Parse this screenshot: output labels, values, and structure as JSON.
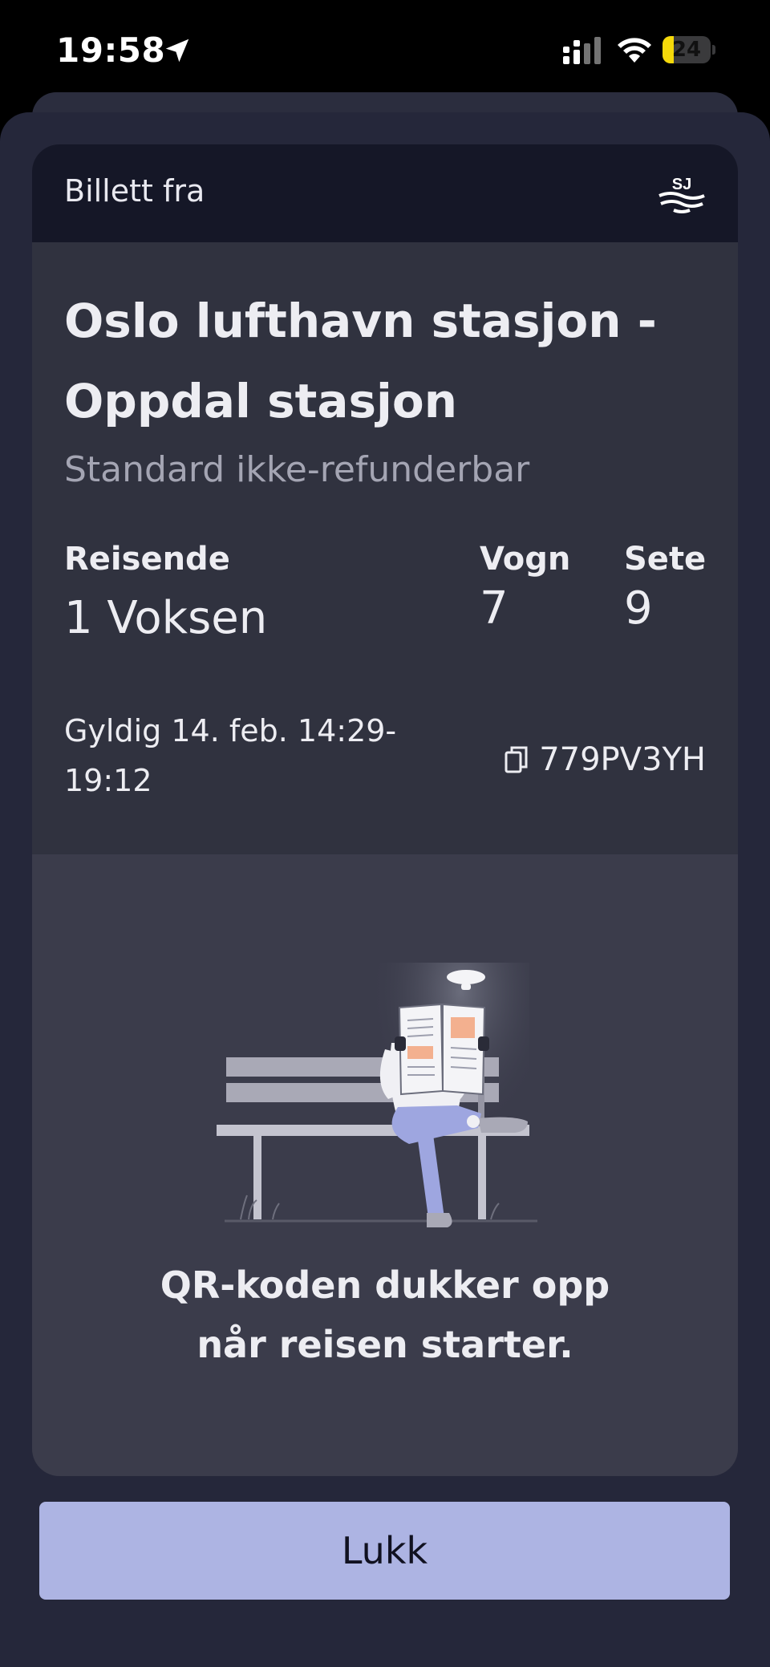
{
  "status_bar": {
    "time": "19:58",
    "battery_percent": "24",
    "battery_level": 0.24,
    "battery_color": "#f5d90a",
    "icons": [
      "location-arrow-icon",
      "cellular-signal-icon",
      "wifi-icon",
      "battery-icon"
    ]
  },
  "ticket": {
    "header_label": "Billett fra",
    "logo_icon": "sj-logo-icon",
    "route": "Oslo lufthavn stasjon - Oppdal stasjon",
    "fare_type": "Standard ikke-refunderbar",
    "travellers_label": "Reisende",
    "travellers_value": "1 Voksen",
    "car_label": "Vogn",
    "car_value": "7",
    "seat_label": "Sete",
    "seat_value": "9",
    "validity": "Gyldig 14. feb. 14:29-19:12",
    "code": "779PV3YH",
    "copy_icon": "copy-icon",
    "qr_message_line1": "QR-koden dukker opp",
    "qr_message_line2": "når reisen starter."
  },
  "actions": {
    "close_label": "Lukk"
  },
  "colors": {
    "background": "#000000",
    "sheet": "#25273a",
    "header": "#151727",
    "card": "#30323f",
    "card_lower": "#3b3c4b",
    "accent_button": "#adb4e3",
    "illustration_accent": "#f3b08f",
    "illustration_legs": "#9ea6e0"
  }
}
